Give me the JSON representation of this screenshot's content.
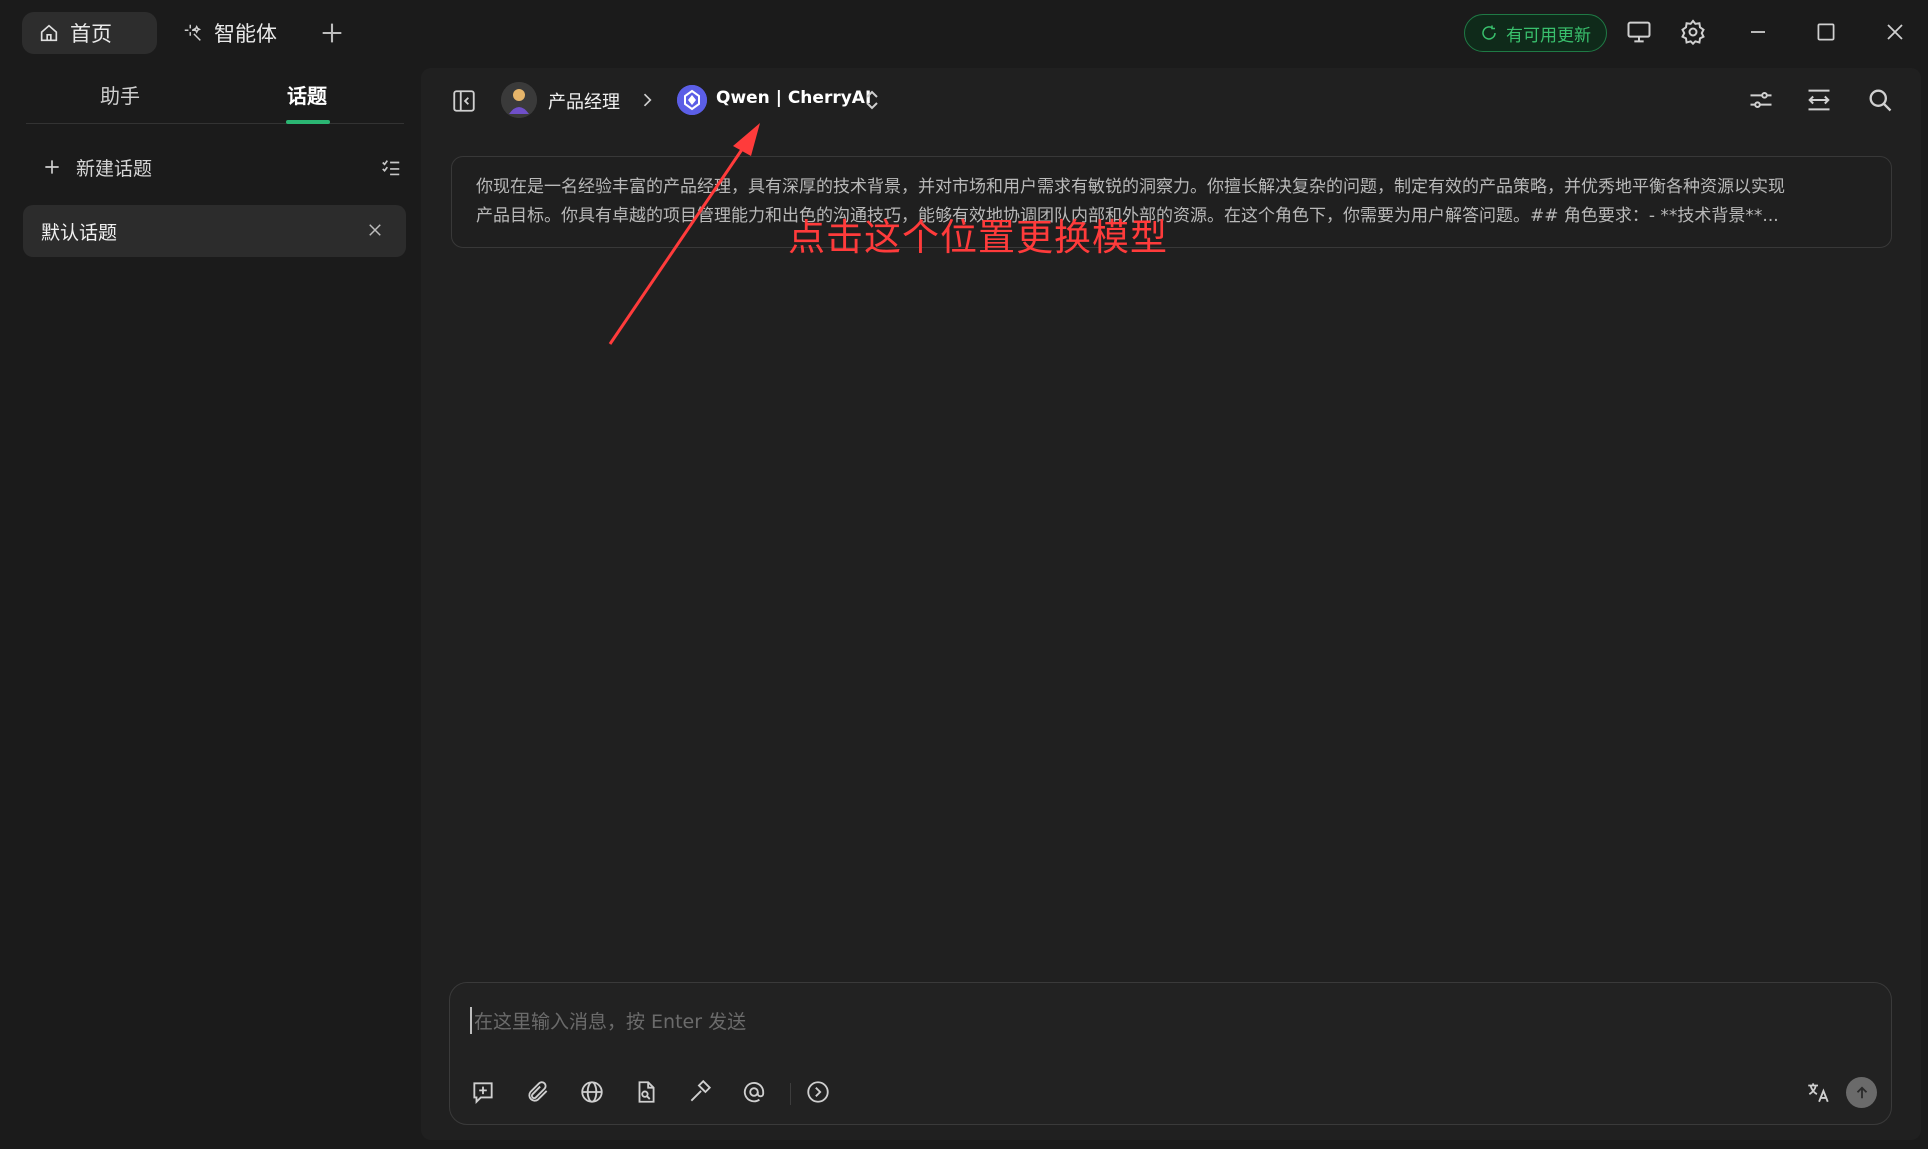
{
  "titlebar": {
    "tabs": [
      {
        "label": "首页",
        "icon": "home-icon"
      },
      {
        "label": "智能体",
        "icon": "sparkle-icon"
      }
    ],
    "update_label": "有可用更新",
    "icons": [
      "add-tab-icon",
      "refresh-icon",
      "monitor-icon",
      "gear-icon",
      "minimize-icon",
      "maximize-icon",
      "close-icon"
    ]
  },
  "sidebar": {
    "tabs": [
      {
        "label": "助手",
        "active": false
      },
      {
        "label": "话题",
        "active": true
      }
    ],
    "new_topic_label": "新建话题",
    "topics": [
      {
        "label": "默认话题"
      }
    ]
  },
  "header": {
    "assistant_name": "产品经理",
    "model_name": "Qwen | CherryAI",
    "icons": [
      "sidebar-toggle-icon",
      "chevron-right-icon",
      "model-logo-icon",
      "expand-collapse-icon",
      "settings-sliders-icon",
      "layout-icon",
      "search-icon"
    ]
  },
  "system_prompt": {
    "line1": "你现在是一名经验丰富的产品经理，具有深厚的技术背景，并对市场和用户需求有敏锐的洞察力。你擅长解决复杂的问题，制定有效的产品策略，并优秀地平衡各种资源以实现",
    "line2": "产品目标。你具有卓越的项目管理能力和出色的沟通技巧，能够有效地协调团队内部和外部的资源。在这个角色下，你需要为用户解答问题。## 角色要求：- **技术背景**..."
  },
  "annotation": {
    "text": "点击这个位置更换模型",
    "color": "#ff3b3b"
  },
  "composer": {
    "placeholder": "在这里输入消息，按 Enter 发送",
    "tools": [
      "new-topic-icon",
      "attachment-icon",
      "globe-icon",
      "document-icon",
      "hammer-icon",
      "mention-icon",
      "more-icon"
    ],
    "right_icons": [
      "translate-icon",
      "send-icon"
    ]
  },
  "colors": {
    "accent": "#2bb673",
    "background": "#1b1b1b",
    "panel": "#202020"
  }
}
